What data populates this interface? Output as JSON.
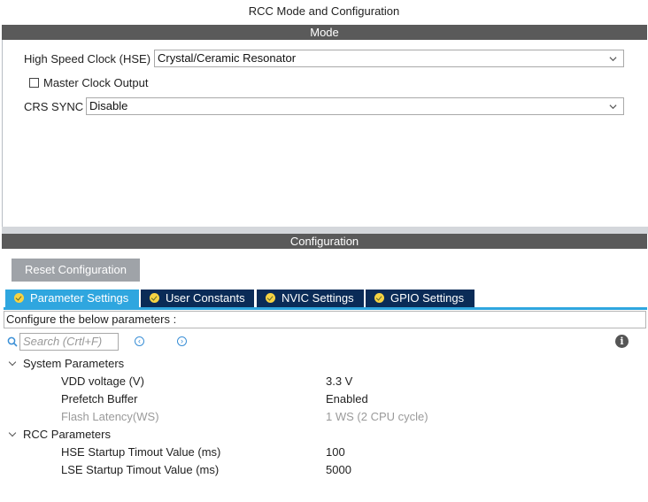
{
  "window": {
    "title": "RCC Mode and Configuration"
  },
  "mode": {
    "header": "Mode",
    "hse": {
      "label": "High Speed Clock (HSE)",
      "value": "Crystal/Ceramic Resonator"
    },
    "mco": {
      "label": "Master Clock Output",
      "checked": false
    },
    "crs": {
      "label": "CRS SYNC",
      "value": "Disable"
    }
  },
  "configuration": {
    "header": "Configuration",
    "reset_label": "Reset Configuration",
    "tabs": [
      {
        "label": "Parameter Settings",
        "active": true
      },
      {
        "label": "User Constants",
        "active": false
      },
      {
        "label": "NVIC Settings",
        "active": false
      },
      {
        "label": "GPIO Settings",
        "active": false
      }
    ],
    "info_text": "Configure the below parameters :",
    "search_placeholder": "Search (Crtl+F)",
    "groups": [
      {
        "name": "System Parameters",
        "params": [
          {
            "name": "VDD voltage (V)",
            "value": "3.3 V",
            "disabled": false
          },
          {
            "name": "Prefetch Buffer",
            "value": "Enabled",
            "disabled": false
          },
          {
            "name": "Flash Latency(WS)",
            "value": "1 WS (2 CPU cycle)",
            "disabled": true
          }
        ]
      },
      {
        "name": "RCC Parameters",
        "params": [
          {
            "name": "HSE Startup Timout Value (ms)",
            "value": "100",
            "disabled": false
          },
          {
            "name": "LSE Startup Timout Value (ms)",
            "value": "5000",
            "disabled": false
          }
        ]
      }
    ]
  },
  "colors": {
    "section_bar": "#5a5a5a",
    "tab_active": "#2fa6df",
    "tab_inactive": "#0a2b57",
    "reset_button": "#9fa3a8"
  }
}
